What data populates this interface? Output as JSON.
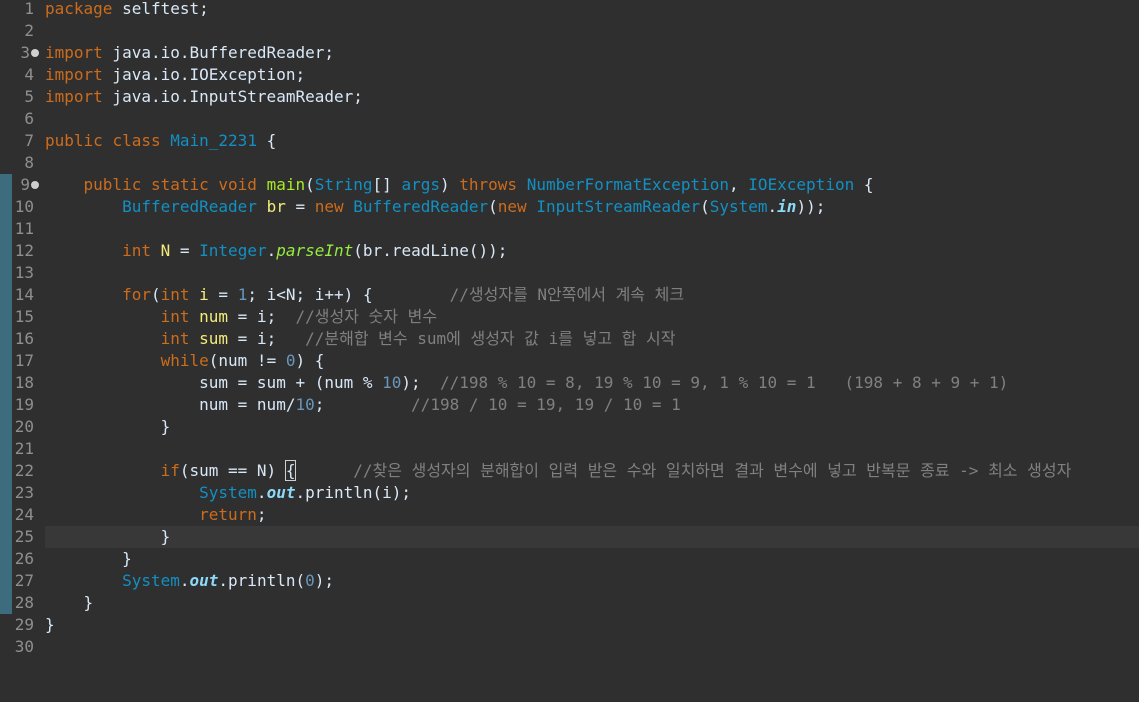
{
  "editor": {
    "lines": [
      {
        "n": "1",
        "text": "package selftest;"
      },
      {
        "n": "2",
        "text": ""
      },
      {
        "n": "3",
        "text": "import java.io.BufferedReader;"
      },
      {
        "n": "4",
        "text": "import java.io.IOException;"
      },
      {
        "n": "5",
        "text": "import java.io.InputStreamReader;"
      },
      {
        "n": "6",
        "text": ""
      },
      {
        "n": "7",
        "text": "public class Main_2231 {"
      },
      {
        "n": "8",
        "text": ""
      },
      {
        "n": "9",
        "text": "    public static void main(String[] args) throws NumberFormatException, IOException {"
      },
      {
        "n": "10",
        "text": "        BufferedReader br = new BufferedReader(new InputStreamReader(System.in));"
      },
      {
        "n": "11",
        "text": ""
      },
      {
        "n": "12",
        "text": "        int N = Integer.parseInt(br.readLine());"
      },
      {
        "n": "13",
        "text": ""
      },
      {
        "n": "14",
        "text": "        for(int i = 1; i<N; i++) {        //생성자를 N안쪽에서 계속 체크"
      },
      {
        "n": "15",
        "text": "            int num = i;  //생성자 숫자 변수"
      },
      {
        "n": "16",
        "text": "            int sum = i;   //분해합 변수 sum에 생성자 값 i를 넣고 합 시작"
      },
      {
        "n": "17",
        "text": "            while(num != 0) {"
      },
      {
        "n": "18",
        "text": "                sum = sum + (num % 10);  //198 % 10 = 8, 19 % 10 = 9, 1 % 10 = 1   (198 + 8 + 9 + 1)"
      },
      {
        "n": "19",
        "text": "                num = num/10;         //198 / 10 = 19, 19 / 10 = 1"
      },
      {
        "n": "20",
        "text": "            }"
      },
      {
        "n": "21",
        "text": ""
      },
      {
        "n": "22",
        "text": "            if(sum == N) {      //찾은 생성자의 분해합이 입력 받은 수와 일치하면 결과 변수에 넣고 반복문 종료 -> 최소 생성자"
      },
      {
        "n": "23",
        "text": "                System.out.println(i);"
      },
      {
        "n": "24",
        "text": "                return;"
      },
      {
        "n": "25",
        "text": "            }"
      },
      {
        "n": "26",
        "text": "        }"
      },
      {
        "n": "27",
        "text": "        System.out.println(0);"
      },
      {
        "n": "28",
        "text": "    }"
      },
      {
        "n": "29",
        "text": "}"
      },
      {
        "n": "30",
        "text": ""
      }
    ],
    "current_line": "25"
  },
  "colors": {
    "background": "#2f2f2f",
    "keyword": "#cc6c1d",
    "type": "#1290c3",
    "method": "#a7ec21",
    "comment": "#808080",
    "number": "#6897bb",
    "text": "#d9e8f7",
    "change_bar": "#3d6c7e"
  }
}
